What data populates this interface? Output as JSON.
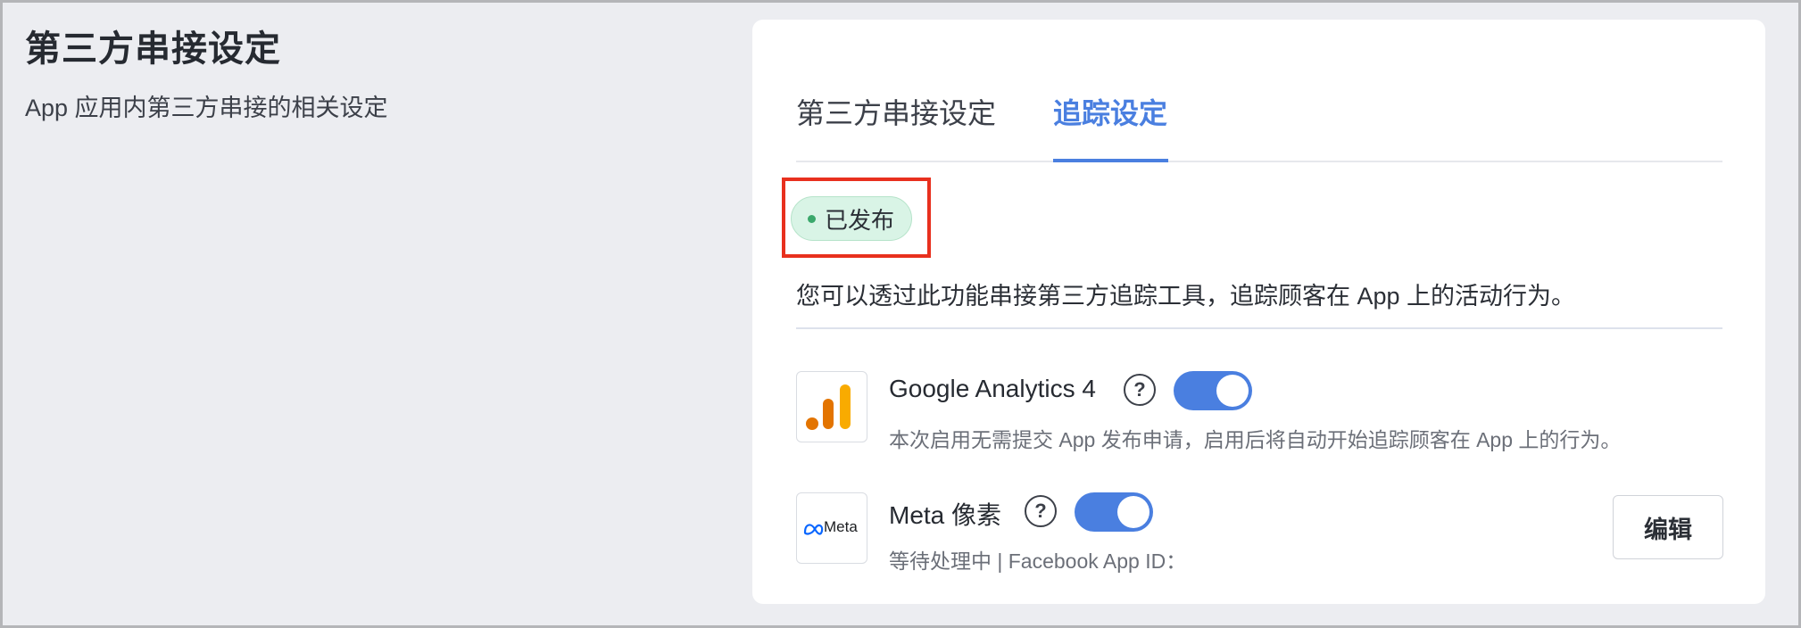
{
  "left": {
    "title": "第三方串接设定",
    "description": "App 应用内第三方串接的相关设定"
  },
  "tabs": [
    {
      "label": "第三方串接设定",
      "active": false
    },
    {
      "label": "追踪设定",
      "active": true
    }
  ],
  "status": {
    "label": "已发布",
    "color": "#3aa86b"
  },
  "intro": "您可以透过此功能串接第三方追踪工具，追踪顾客在 App 上的活动行为。",
  "integrations": [
    {
      "name": "Google Analytics 4",
      "icon": "google-analytics-icon",
      "enabled": true,
      "subtitle": "本次启用无需提交 App 发布申请，启用后将自动开始追踪顾客在 App 上的行为。"
    },
    {
      "name": "Meta 像素",
      "icon": "meta-icon",
      "logo_text": "Meta",
      "enabled": true,
      "subtitle": "等待处理中 | Facebook App ID：",
      "edit_label": "编辑"
    }
  ],
  "help_glyph": "?",
  "colors": {
    "accent": "#4a7fe0",
    "highlight": "#e8301e"
  }
}
